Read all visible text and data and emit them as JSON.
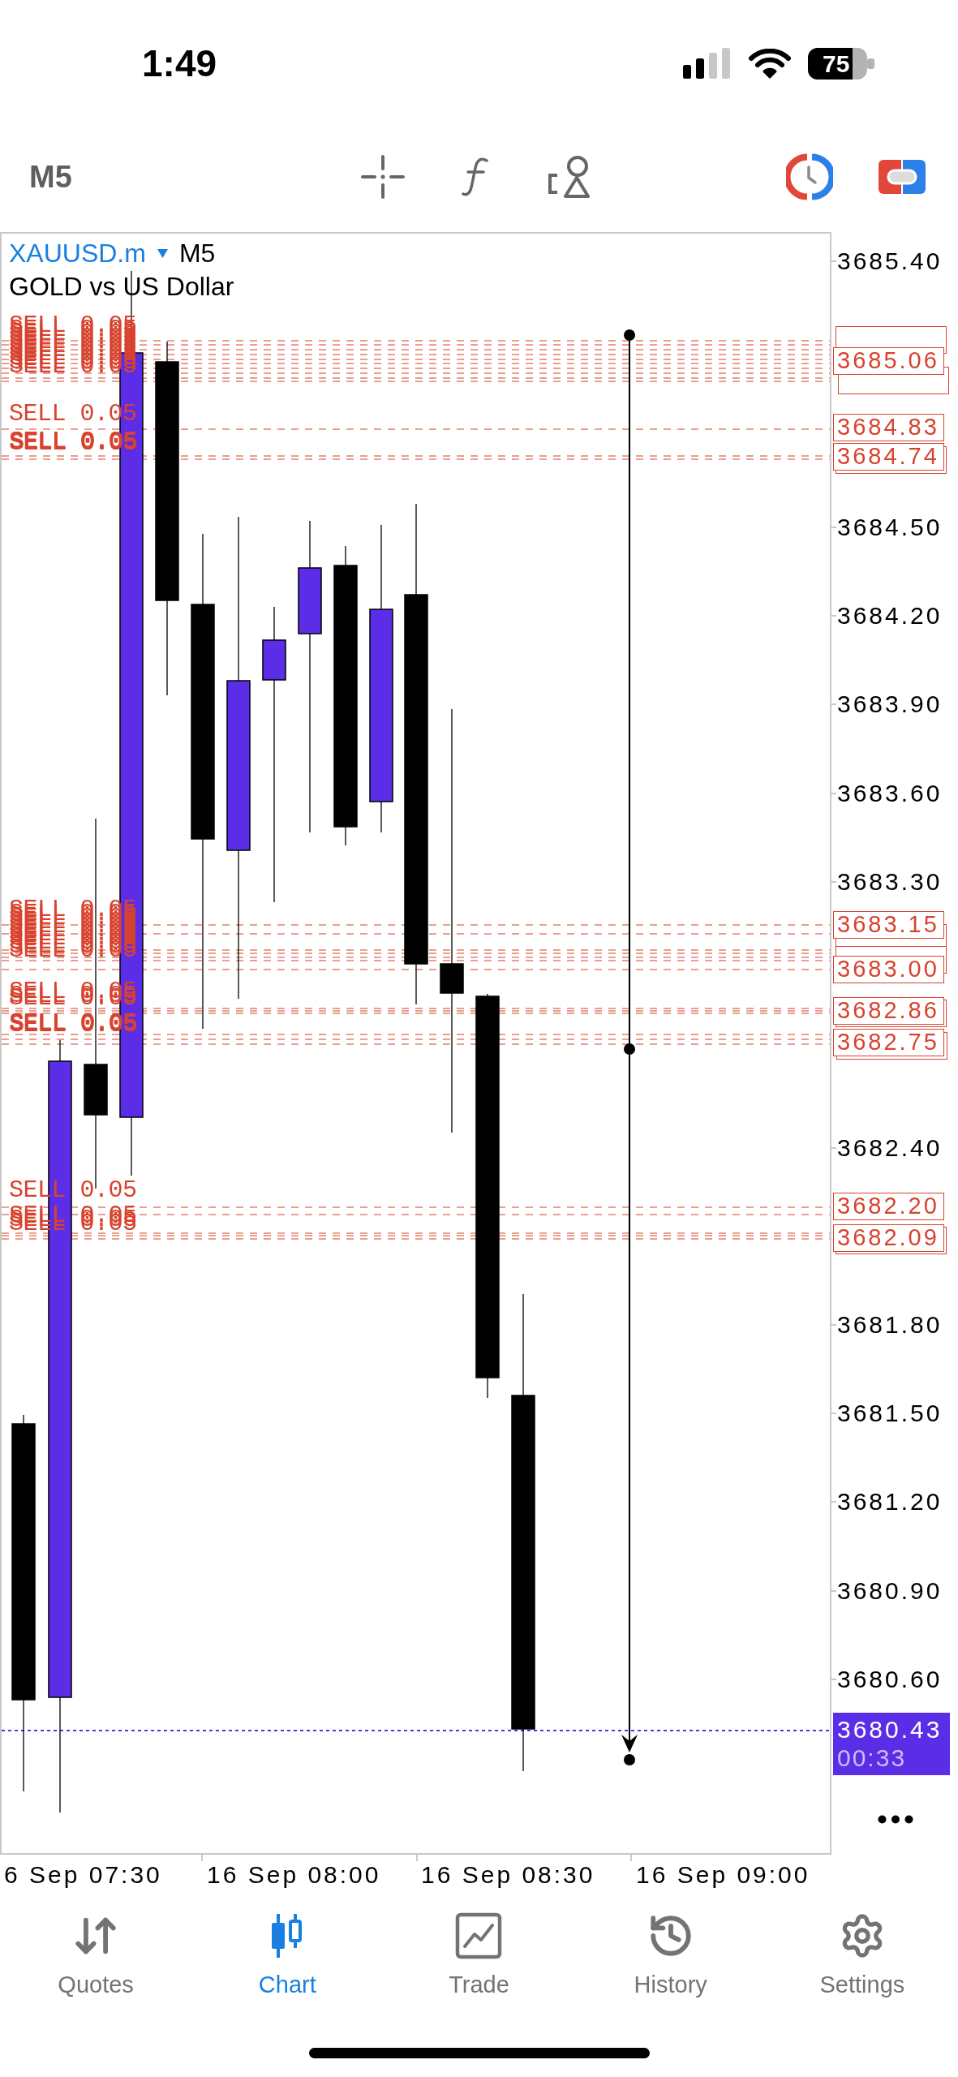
{
  "status_bar": {
    "time": "1:49",
    "battery": "75"
  },
  "toolbar": {
    "timeframe": "M5"
  },
  "chart": {
    "symbol": "XAUUSD.m",
    "timeframe": "M5",
    "description": "GOLD vs US Dollar",
    "order_labels": [
      {
        "text": "SELL 0.05",
        "kind": "stacked"
      },
      {
        "text": "SELL 0.05",
        "kind": "single"
      },
      {
        "text": "SELL 0.05",
        "kind": "doubled"
      },
      {
        "text": "SELL 0.05",
        "kind": "stacked"
      },
      {
        "text": "SELL 0.05",
        "kind": "stacked"
      },
      {
        "text": "SELL 0.05",
        "kind": "doubled"
      },
      {
        "text": "SELL 0.05",
        "kind": "single"
      },
      {
        "text": "SELL 0.05",
        "kind": "stacked"
      }
    ],
    "price_axis": [
      "3685.40",
      "3684.50",
      "3684.20",
      "3683.90",
      "3683.60",
      "3683.30",
      "3682.40",
      "3681.80",
      "3681.50",
      "3681.20",
      "3680.90",
      "3680.60"
    ],
    "order_price_tags": [
      {
        "text": "3685.06",
        "kind": "stacked"
      },
      {
        "text": "3684.83",
        "kind": "single"
      },
      {
        "text": "3684.74",
        "kind": "stacked"
      },
      {
        "text": "3683.15",
        "kind": "stacked"
      },
      {
        "text": "3683.00",
        "kind": "stacked"
      },
      {
        "text": "3682.86",
        "kind": "stacked"
      },
      {
        "text": "3682.75",
        "kind": "stacked"
      },
      {
        "text": "3682.20",
        "kind": "single"
      },
      {
        "text": "3682.09",
        "kind": "stacked"
      }
    ],
    "current_price": {
      "price": "3680.43",
      "countdown": "00:33"
    },
    "time_axis": [
      "6 Sep 07:30",
      "16 Sep 08:00",
      "16 Sep 08:30",
      "16 Sep 09:00"
    ]
  },
  "tabs": [
    {
      "label": "Quotes",
      "selected": false
    },
    {
      "label": "Chart",
      "selected": true
    },
    {
      "label": "Trade",
      "selected": false
    },
    {
      "label": "History",
      "selected": false
    },
    {
      "label": "Settings",
      "selected": false
    }
  ]
}
